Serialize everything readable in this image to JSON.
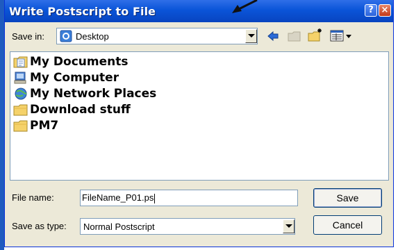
{
  "titlebar": {
    "title": "Write Postscript to File",
    "help": "?",
    "close": "×"
  },
  "save_in": {
    "label": "Save in:",
    "value": "Desktop",
    "icon": "desktop-icon"
  },
  "toolbar": {
    "icons": [
      "back-arrow-icon",
      "up-folder-icon",
      "new-folder-icon",
      "view-menu-icon"
    ]
  },
  "files": [
    {
      "label": "My Documents",
      "icon": "my-documents-icon"
    },
    {
      "label": "My Computer",
      "icon": "my-computer-icon"
    },
    {
      "label": "My Network Places",
      "icon": "network-places-icon"
    },
    {
      "label": "Download stuff",
      "icon": "folder-icon"
    },
    {
      "label": "PM7",
      "icon": "folder-icon"
    }
  ],
  "file_name": {
    "label": "File name:",
    "value": "FileName_P01.ps"
  },
  "save_as_type": {
    "label": "Save as type:",
    "value": "Normal Postscript"
  },
  "buttons": {
    "save": "Save",
    "cancel": "Cancel"
  },
  "colors": {
    "titlebar": "#0a54d8",
    "dialog_bg": "#ece9d8",
    "folder": "#f5d26a"
  }
}
